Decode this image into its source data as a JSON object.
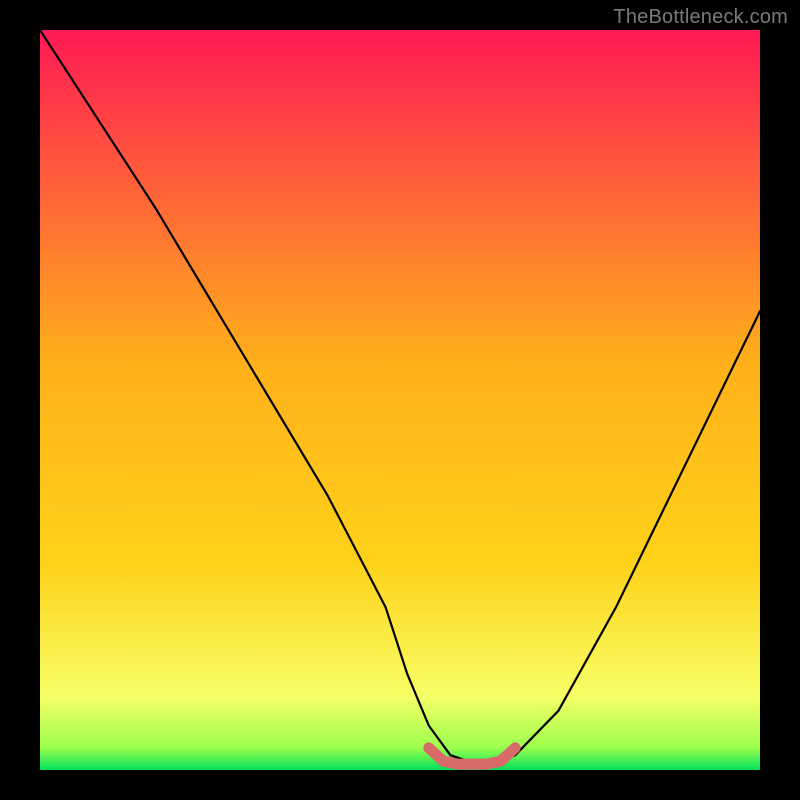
{
  "watermark": "TheBottleneck.com",
  "chart_data": {
    "type": "line",
    "title": "",
    "xlabel": "",
    "ylabel": "",
    "xlim": [
      0,
      100
    ],
    "ylim": [
      0,
      100
    ],
    "series": [
      {
        "name": "bottleneck-curve",
        "x": [
          0,
          8,
          16,
          24,
          32,
          40,
          48,
          51,
          54,
          57,
          60,
          63,
          66,
          72,
          80,
          88,
          96,
          100
        ],
        "y": [
          100,
          88,
          76,
          63,
          50,
          37,
          22,
          13,
          6,
          2,
          1,
          1,
          2,
          8,
          22,
          38,
          54,
          62
        ]
      },
      {
        "name": "optimal-range-marker",
        "x": [
          54,
          56,
          58,
          60,
          62,
          64,
          66
        ],
        "y": [
          3,
          1.2,
          0.8,
          0.8,
          0.8,
          1.2,
          3
        ]
      }
    ],
    "background_gradient": {
      "top": "#ff1a55",
      "mid": "#ffd21a",
      "low": "#f7ff66",
      "bottom": "#00e05a"
    },
    "curve_color": "#000000",
    "marker_color": "#d86a6a"
  }
}
